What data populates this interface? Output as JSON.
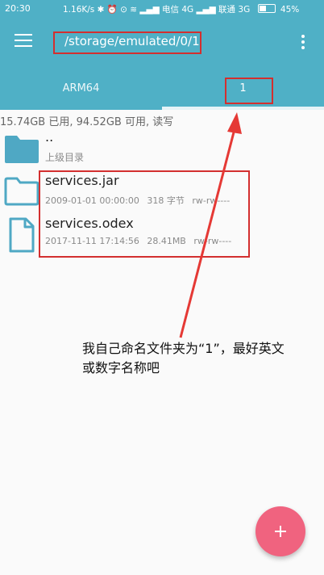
{
  "status_bar": {
    "time": "20:30",
    "right_text": "1.16K/s ✱ ⏰ ⊙ ≋ ▂▄▆ 电信 4G ▂▄▆ 联通 3G",
    "battery": "45%"
  },
  "toolbar": {
    "path": "/storage/emulated/0/1"
  },
  "tabs": [
    {
      "label": "ARM64"
    },
    {
      "label": "1"
    }
  ],
  "storage_info": "15.74GB 已用, 94.52GB 可用, 读写",
  "parent_row": {
    "name": "..",
    "subtitle": "上级目录"
  },
  "files": [
    {
      "name": "services.jar",
      "date": "2009-01-01 00:00:00",
      "size": "318 字节",
      "perms": "rw-rw----"
    },
    {
      "name": "services.odex",
      "date": "2017-11-11 17:14:56",
      "size": "28.41MB",
      "perms": "rw-rw----"
    }
  ],
  "annotation": {
    "line1": "我自己命名文件夹为“1”，最好英文",
    "line2": "或数字名称吧"
  },
  "colors": {
    "primary": "#4fb0c6",
    "fab": "#f0637f",
    "annotation_red": "#d32f2f",
    "folder": "#4fa8c4"
  }
}
